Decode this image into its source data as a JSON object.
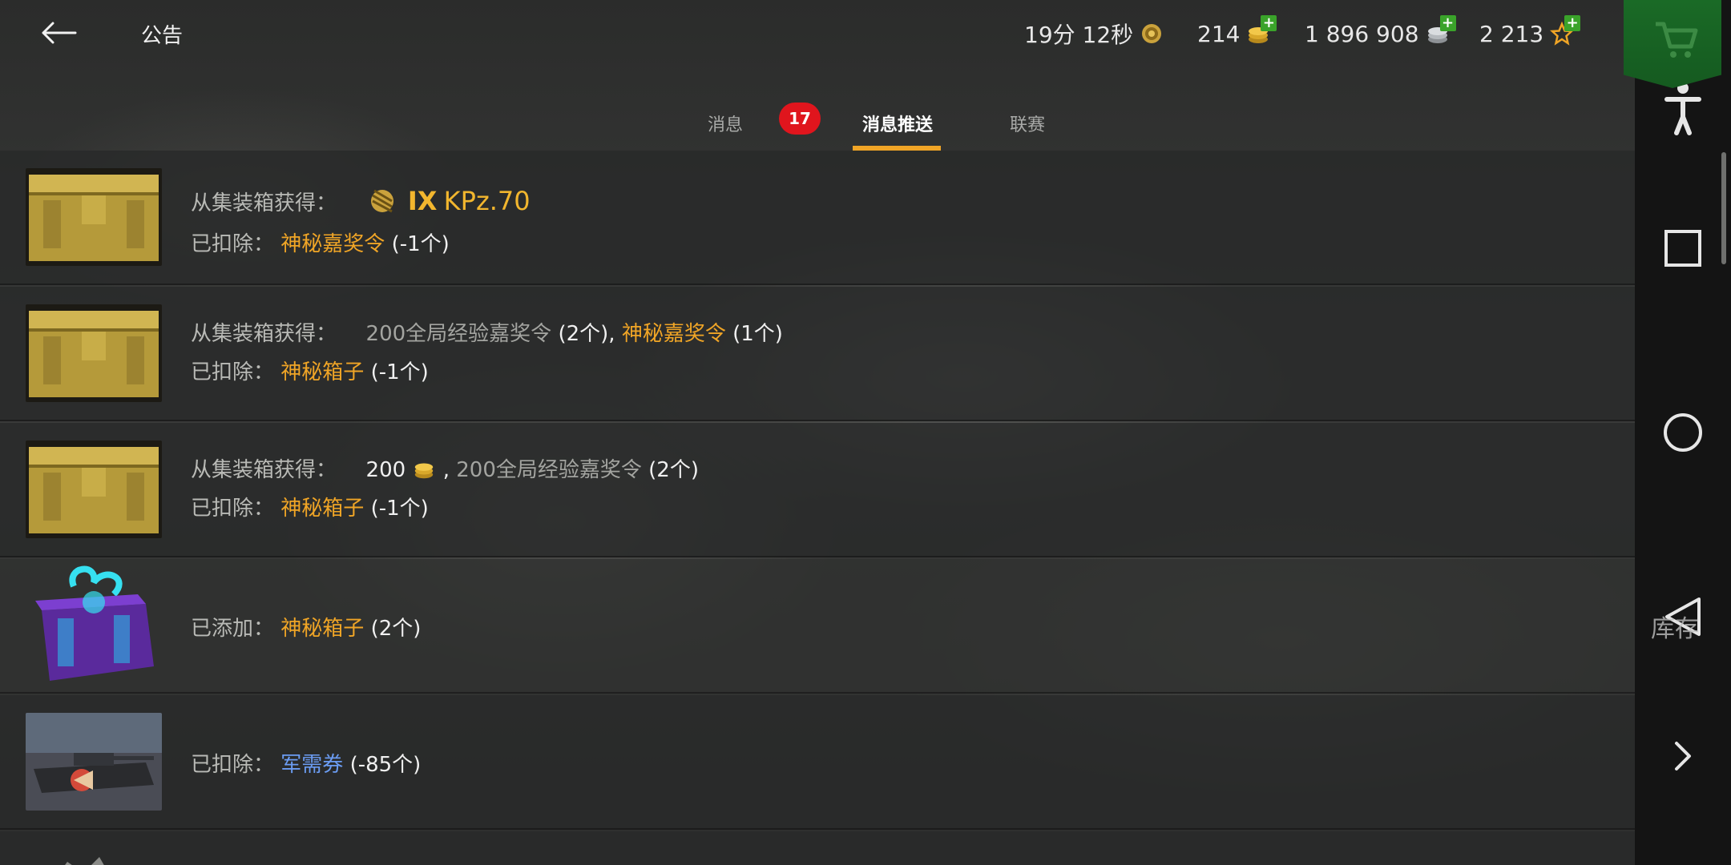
{
  "header": {
    "title": "公告",
    "timer": "19分 12秒",
    "gold": "214",
    "silver": "1 896 908",
    "free_xp": "2 213"
  },
  "tabs": [
    {
      "label": "消息",
      "badge": "17"
    },
    {
      "label": "消息推送"
    },
    {
      "label": "联赛"
    }
  ],
  "messages": [
    {
      "line1_label": "从集装箱获得：",
      "line1_tier": "IX",
      "line1_item": "KPz.70",
      "line2_label": "已扣除：",
      "line2_item": "神秘嘉奖令",
      "line2_count": "(-1个)"
    },
    {
      "line1_label": "从集装箱获得：",
      "line1_item_a": "200全局经验嘉奖令",
      "line1_count_a": "(2个),",
      "line1_item_b": "神秘嘉奖令",
      "line1_count_b": "(1个)",
      "line2_label": "已扣除：",
      "line2_item": "神秘箱子",
      "line2_count": "(-1个)"
    },
    {
      "line1_label": "从集装箱获得：",
      "line1_amount": "200",
      "line1_sep": ",",
      "line1_item": "200全局经验嘉奖令",
      "line1_count": "(2个)",
      "line2_label": "已扣除：",
      "line2_item": "神秘箱子",
      "line2_count": "(-1个)"
    },
    {
      "line1_label": "已添加：",
      "line1_item": "神秘箱子",
      "line1_count": "(2个)"
    },
    {
      "line1_label": "已扣除：",
      "line1_item": "军需券",
      "line1_count": "(-85个)"
    }
  ],
  "side": {
    "storage_label": "库存"
  },
  "colors": {
    "accent": "#f0a526",
    "badge": "#e0151d",
    "link_blue": "#6b9cf2",
    "shop_green": "#1a6a26"
  },
  "icons": [
    "back-arrow-icon",
    "timer-medal-icon",
    "gold-coins-icon",
    "silver-coins-icon",
    "free-xp-star-icon",
    "shop-cart-icon",
    "person-icon",
    "square-nav-icon",
    "circle-nav-icon",
    "triangle-back-nav-icon",
    "chevron-right-icon",
    "elite-tier-icon"
  ]
}
